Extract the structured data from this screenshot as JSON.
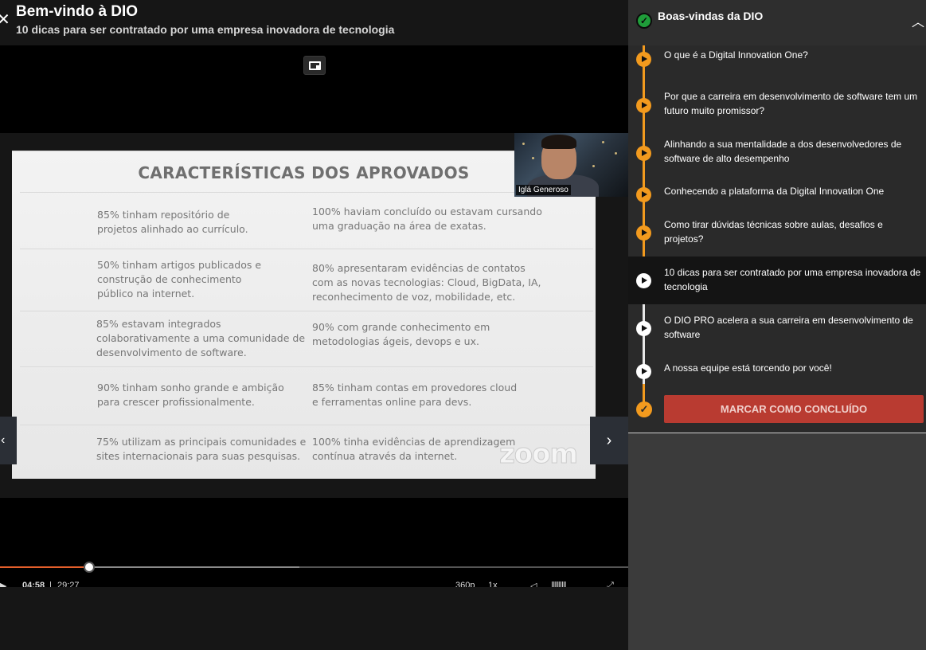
{
  "header": {
    "course_title": "Bem-vindo à DIO",
    "lesson_title": "10 dicas para ser contratado por uma empresa inovadora de tecnologia"
  },
  "slide": {
    "title": "CARACTERÍSTICAS DOS APROVADOS",
    "rows": [
      {
        "left": "85% tinham repositório de\nprojetos alinhado ao currículo.",
        "right": "100% haviam concluído ou estavam cursando\numa graduação na área de exatas."
      },
      {
        "left": "50% tinham artigos publicados e\nconstrução de conhecimento\npúblico na internet.",
        "right": "80% apresentaram evidências de contatos\ncom as novas tecnologias: Cloud, BigData, IA,\nreconhecimento de voz, mobilidade, etc."
      },
      {
        "left": "85% estavam integrados\ncolaborativamente a uma comunidade de\ndesenvolvimento de software.",
        "right": "90% com grande conhecimento em\nmetodologias ágeis, devops e ux."
      },
      {
        "left": "90% tinham sonho grande e ambição\npara crescer profissionalmente.",
        "right": "85% tinham contas em provedores cloud\ne ferramentas online para devs."
      },
      {
        "left": "75% utilizam as principais comunidades e\nsites internacionais para suas pesquisas.",
        "right": "100% tinha evidências de aprendizagem\ncontínua através da internet."
      }
    ],
    "webcam_name": "Iglá Generoso",
    "watermark": "zoom"
  },
  "player": {
    "played_fraction": 0.142,
    "buffered_fraction": 0.476,
    "current_time": "04:58",
    "total_time": "29:27",
    "quality": "360p",
    "speed": "1x"
  },
  "sidebar": {
    "module_title": "Boas-vindas da DIO",
    "lessons": [
      {
        "label": "O que é a Digital Innovation One?",
        "status": "done"
      },
      {
        "label": "Por que a carreira em desenvolvimento de software tem um futuro muito promissor?",
        "status": "done"
      },
      {
        "label": "Alinhando a sua mentalidade a dos desenvolvedores de software de alto desempenho",
        "status": "done"
      },
      {
        "label": "Conhecendo a plataforma da Digital Innovation One",
        "status": "done"
      },
      {
        "label": "Como tirar dúvidas técnicas sobre aulas, desafios e projetos?",
        "status": "done"
      },
      {
        "label": "10 dicas para ser contratado por uma empresa inovadora de tecnologia",
        "status": "current"
      },
      {
        "label": "O DIO PRO acelera a sua carreira em desenvolvimento de software",
        "status": "todo"
      },
      {
        "label": "A nossa equipe está torcendo por você!",
        "status": "todo"
      }
    ],
    "complete_button": "MARCAR COMO CONCLUÍDO"
  },
  "icons": {
    "back": "close-icon",
    "pip": "picture-in-picture-icon",
    "prev": "chevron-left-icon",
    "next": "chevron-right-icon",
    "collapse": "chevron-up-icon",
    "module_status": "check-circle-icon",
    "lesson_done": "play-circle-icon",
    "complete": "check-circle-icon"
  },
  "colors": {
    "accent": "#f29a1e",
    "button": "#b93b31",
    "progress": "#e45f2b",
    "module_check": "#1f9d3a"
  }
}
